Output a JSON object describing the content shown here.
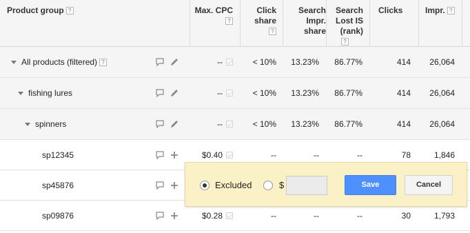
{
  "header": {
    "product_group": "Product group",
    "max_cpc": "Max. CPC",
    "click_share_1": "Click",
    "click_share_2": "share",
    "search_impr_share_1": "Search",
    "search_impr_share_2": "Impr.",
    "search_impr_share_3": "share",
    "search_lost_is_1": "Search",
    "search_lost_is_2": "Lost IS",
    "search_lost_is_3": "(rank)",
    "clicks": "Clicks",
    "impr": "Impr.",
    "help_glyph": "?"
  },
  "rows": [
    {
      "name": "All products (filtered)",
      "max_cpc": "--",
      "click_share": "< 10%",
      "search_impr_share": "13.23%",
      "search_lost_is": "86.77%",
      "clicks": "414",
      "impr": "26,064"
    },
    {
      "name": "fishing lures",
      "max_cpc": "--",
      "click_share": "< 10%",
      "search_impr_share": "13.23%",
      "search_lost_is": "86.77%",
      "clicks": "414",
      "impr": "26,064"
    },
    {
      "name": "spinners",
      "max_cpc": "--",
      "click_share": "< 10%",
      "search_impr_share": "13.23%",
      "search_lost_is": "86.77%",
      "clicks": "414",
      "impr": "26,064"
    },
    {
      "name": "sp12345",
      "max_cpc": "$0.40",
      "click_share": "--",
      "search_impr_share": "--",
      "search_lost_is": "--",
      "clicks": "78",
      "impr": "1,846"
    },
    {
      "name": "sp45876",
      "max_cpc": "",
      "click_share": "",
      "search_impr_share": "",
      "search_lost_is": "",
      "clicks": "",
      "impr": ""
    },
    {
      "name": "sp09876",
      "max_cpc": "$0.28",
      "click_share": "--",
      "search_impr_share": "--",
      "search_lost_is": "--",
      "clicks": "30",
      "impr": "1,793"
    }
  ],
  "bid_editor": {
    "excluded_label": "Excluded",
    "excluded_selected": true,
    "currency_symbol": "$",
    "bid_value": "",
    "save_label": "Save",
    "cancel_label": "Cancel"
  },
  "colors": {
    "save_button": "#4d90fe",
    "popup_background": "#fbf1c6",
    "header_background": "#f5f5f5"
  }
}
